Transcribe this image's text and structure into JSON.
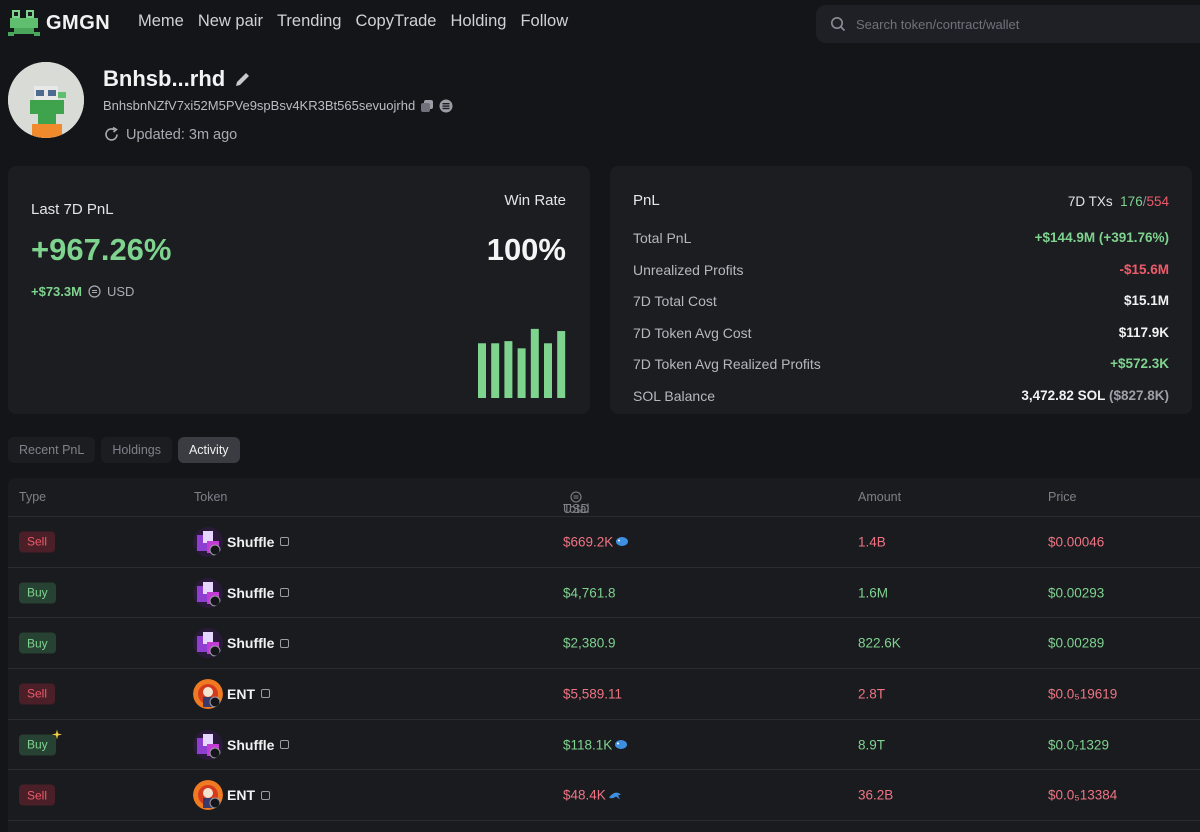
{
  "brand": {
    "name": "GMGN"
  },
  "nav": [
    "Meme",
    "New pair",
    "Trending",
    "CopyTrade",
    "Holding",
    "Follow"
  ],
  "search": {
    "placeholder": "Search token/contract/wallet"
  },
  "profile": {
    "name": "Bnhsb...rhd",
    "address": "BnhsbnNZfV7xi52M5PVe9spBsv4KR3Bt565sevuojrhd",
    "updated": "Updated: 3m ago"
  },
  "pnl_card": {
    "label": "Last 7D PnL",
    "percent": "+967.26%",
    "usd_value": "+$73.3M",
    "usd_label": "USD",
    "win_rate_label": "Win Rate",
    "win_rate": "100%",
    "bar_levels": [
      0.76,
      0.76,
      0.79,
      0.69,
      0.96,
      0.76,
      0.93
    ],
    "bar_color": "#7ed38f"
  },
  "stats_card": {
    "title": "PnL",
    "tx_label": "7D TXs",
    "tx_buys": "176",
    "tx_sep": "/",
    "tx_sells": "554",
    "rows": [
      {
        "label": "Total PnL",
        "value": "+$144.9M (+391.76%)",
        "tone": "green"
      },
      {
        "label": "Unrealized Profits",
        "value": "-$15.6M",
        "tone": "red"
      },
      {
        "label": "7D Total Cost",
        "value": "$15.1M",
        "tone": "white"
      },
      {
        "label": "7D Token Avg Cost",
        "value": "$117.9K",
        "tone": "white"
      },
      {
        "label": "7D Token Avg Realized Profits",
        "value": "+$572.3K",
        "tone": "green"
      }
    ],
    "sol_label": "SOL Balance",
    "sol_value": "3,472.82 SOL",
    "sol_usd": "($827.8K)"
  },
  "tabs": [
    {
      "label": "Recent PnL",
      "active": false
    },
    {
      "label": "Holdings",
      "active": false
    },
    {
      "label": "Activity",
      "active": true
    }
  ],
  "table": {
    "headers": {
      "type": "Type",
      "token": "Token",
      "total": "Total",
      "total_unit": "USD",
      "amount": "Amount",
      "price": "Price"
    },
    "rows": [
      {
        "type": "Sell",
        "token": "Shuffle",
        "total": "$669.2K",
        "amount": "1.4B",
        "price": "$0.00046",
        "icon": "whale-icon",
        "extra": ""
      },
      {
        "type": "Buy",
        "token": "Shuffle",
        "total": "$4,761.8",
        "amount": "1.6M",
        "price": "$0.00293",
        "icon": "",
        "extra": ""
      },
      {
        "type": "Buy",
        "token": "Shuffle",
        "total": "$2,380.9",
        "amount": "822.6K",
        "price": "$0.00289",
        "icon": "",
        "extra": ""
      },
      {
        "type": "Sell",
        "token": "ENT",
        "total": "$5,589.11",
        "amount": "2.8T",
        "price": "$0.0₅19619",
        "icon": "",
        "extra": ""
      },
      {
        "type": "Buy",
        "token": "Shuffle",
        "total": "$118.1K",
        "amount": "8.9T",
        "price": "$0.0₇1329",
        "icon": "whale-icon",
        "extra": "sparkle-icon"
      },
      {
        "type": "Sell",
        "token": "ENT",
        "total": "$48.4K",
        "amount": "36.2B",
        "price": "$0.0₅13384",
        "icon": "dolphin-icon",
        "extra": ""
      }
    ]
  }
}
